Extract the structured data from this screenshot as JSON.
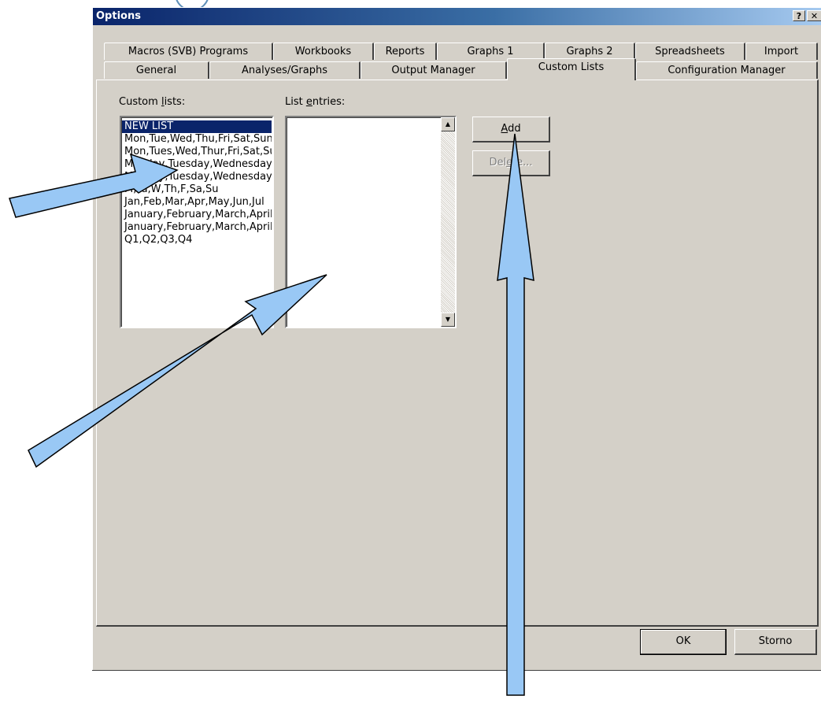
{
  "window": {
    "title": "Options",
    "help_label": "?",
    "close_label": "✕"
  },
  "tabs_row1": [
    {
      "label": "Macros (SVB) Programs"
    },
    {
      "label": "Workbooks"
    },
    {
      "label": "Reports"
    },
    {
      "label": "Graphs 1"
    },
    {
      "label": "Graphs 2"
    },
    {
      "label": "Spreadsheets"
    },
    {
      "label": "Import"
    }
  ],
  "tabs_row2": [
    {
      "label": "General"
    },
    {
      "label": "Analyses/Graphs"
    },
    {
      "label": "Output Manager"
    },
    {
      "label": "Custom Lists",
      "active": true
    },
    {
      "label": "Configuration Manager"
    }
  ],
  "custom_lists": {
    "label_pre": "Custom ",
    "label_accel": "l",
    "label_post": "ists:",
    "items": [
      "NEW LIST",
      "Mon,Tue,Wed,Thu,Fri,Sat,Sun",
      "Mon,Tues,Wed,Thur,Fri,Sat,Sun",
      "Monday,Tuesday,Wednesday",
      "Monday,Tuesday,Wednesday",
      "M,Tu,W,Th,F,Sa,Su",
      "Jan,Feb,Mar,Apr,May,Jun,Jul",
      "January,February,March,April",
      "January,February,March,April",
      "Q1,Q2,Q3,Q4"
    ],
    "selected_index": 0
  },
  "list_entries": {
    "label_pre": "List ",
    "label_accel": "e",
    "label_post": "ntries:"
  },
  "buttons": {
    "add_accel": "A",
    "add_rest": "dd",
    "delete_pre": "Del",
    "delete_accel": "e",
    "delete_post": "te...",
    "ok_label": "OK",
    "storno_label": "Storno"
  },
  "scroll": {
    "up_glyph": "▲",
    "down_glyph": "▼"
  },
  "colors": {
    "arrow_fill": "#99c8f5",
    "arrow_stroke": "#000000",
    "dialog_face": "#d4d0c8",
    "selection": "#0a246a"
  }
}
